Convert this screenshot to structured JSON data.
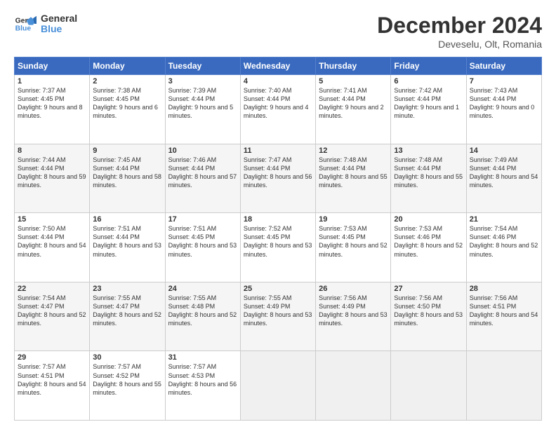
{
  "header": {
    "logo_general": "General",
    "logo_blue": "Blue",
    "month_title": "December 2024",
    "location": "Deveselu, Olt, Romania"
  },
  "days_of_week": [
    "Sunday",
    "Monday",
    "Tuesday",
    "Wednesday",
    "Thursday",
    "Friday",
    "Saturday"
  ],
  "weeks": [
    [
      {
        "day": "1",
        "sunrise": "Sunrise: 7:37 AM",
        "sunset": "Sunset: 4:45 PM",
        "daylight": "Daylight: 9 hours and 8 minutes."
      },
      {
        "day": "2",
        "sunrise": "Sunrise: 7:38 AM",
        "sunset": "Sunset: 4:45 PM",
        "daylight": "Daylight: 9 hours and 6 minutes."
      },
      {
        "day": "3",
        "sunrise": "Sunrise: 7:39 AM",
        "sunset": "Sunset: 4:44 PM",
        "daylight": "Daylight: 9 hours and 5 minutes."
      },
      {
        "day": "4",
        "sunrise": "Sunrise: 7:40 AM",
        "sunset": "Sunset: 4:44 PM",
        "daylight": "Daylight: 9 hours and 4 minutes."
      },
      {
        "day": "5",
        "sunrise": "Sunrise: 7:41 AM",
        "sunset": "Sunset: 4:44 PM",
        "daylight": "Daylight: 9 hours and 2 minutes."
      },
      {
        "day": "6",
        "sunrise": "Sunrise: 7:42 AM",
        "sunset": "Sunset: 4:44 PM",
        "daylight": "Daylight: 9 hours and 1 minute."
      },
      {
        "day": "7",
        "sunrise": "Sunrise: 7:43 AM",
        "sunset": "Sunset: 4:44 PM",
        "daylight": "Daylight: 9 hours and 0 minutes."
      }
    ],
    [
      {
        "day": "8",
        "sunrise": "Sunrise: 7:44 AM",
        "sunset": "Sunset: 4:44 PM",
        "daylight": "Daylight: 8 hours and 59 minutes."
      },
      {
        "day": "9",
        "sunrise": "Sunrise: 7:45 AM",
        "sunset": "Sunset: 4:44 PM",
        "daylight": "Daylight: 8 hours and 58 minutes."
      },
      {
        "day": "10",
        "sunrise": "Sunrise: 7:46 AM",
        "sunset": "Sunset: 4:44 PM",
        "daylight": "Daylight: 8 hours and 57 minutes."
      },
      {
        "day": "11",
        "sunrise": "Sunrise: 7:47 AM",
        "sunset": "Sunset: 4:44 PM",
        "daylight": "Daylight: 8 hours and 56 minutes."
      },
      {
        "day": "12",
        "sunrise": "Sunrise: 7:48 AM",
        "sunset": "Sunset: 4:44 PM",
        "daylight": "Daylight: 8 hours and 55 minutes."
      },
      {
        "day": "13",
        "sunrise": "Sunrise: 7:48 AM",
        "sunset": "Sunset: 4:44 PM",
        "daylight": "Daylight: 8 hours and 55 minutes."
      },
      {
        "day": "14",
        "sunrise": "Sunrise: 7:49 AM",
        "sunset": "Sunset: 4:44 PM",
        "daylight": "Daylight: 8 hours and 54 minutes."
      }
    ],
    [
      {
        "day": "15",
        "sunrise": "Sunrise: 7:50 AM",
        "sunset": "Sunset: 4:44 PM",
        "daylight": "Daylight: 8 hours and 54 minutes."
      },
      {
        "day": "16",
        "sunrise": "Sunrise: 7:51 AM",
        "sunset": "Sunset: 4:44 PM",
        "daylight": "Daylight: 8 hours and 53 minutes."
      },
      {
        "day": "17",
        "sunrise": "Sunrise: 7:51 AM",
        "sunset": "Sunset: 4:45 PM",
        "daylight": "Daylight: 8 hours and 53 minutes."
      },
      {
        "day": "18",
        "sunrise": "Sunrise: 7:52 AM",
        "sunset": "Sunset: 4:45 PM",
        "daylight": "Daylight: 8 hours and 53 minutes."
      },
      {
        "day": "19",
        "sunrise": "Sunrise: 7:53 AM",
        "sunset": "Sunset: 4:45 PM",
        "daylight": "Daylight: 8 hours and 52 minutes."
      },
      {
        "day": "20",
        "sunrise": "Sunrise: 7:53 AM",
        "sunset": "Sunset: 4:46 PM",
        "daylight": "Daylight: 8 hours and 52 minutes."
      },
      {
        "day": "21",
        "sunrise": "Sunrise: 7:54 AM",
        "sunset": "Sunset: 4:46 PM",
        "daylight": "Daylight: 8 hours and 52 minutes."
      }
    ],
    [
      {
        "day": "22",
        "sunrise": "Sunrise: 7:54 AM",
        "sunset": "Sunset: 4:47 PM",
        "daylight": "Daylight: 8 hours and 52 minutes."
      },
      {
        "day": "23",
        "sunrise": "Sunrise: 7:55 AM",
        "sunset": "Sunset: 4:47 PM",
        "daylight": "Daylight: 8 hours and 52 minutes."
      },
      {
        "day": "24",
        "sunrise": "Sunrise: 7:55 AM",
        "sunset": "Sunset: 4:48 PM",
        "daylight": "Daylight: 8 hours and 52 minutes."
      },
      {
        "day": "25",
        "sunrise": "Sunrise: 7:55 AM",
        "sunset": "Sunset: 4:49 PM",
        "daylight": "Daylight: 8 hours and 53 minutes."
      },
      {
        "day": "26",
        "sunrise": "Sunrise: 7:56 AM",
        "sunset": "Sunset: 4:49 PM",
        "daylight": "Daylight: 8 hours and 53 minutes."
      },
      {
        "day": "27",
        "sunrise": "Sunrise: 7:56 AM",
        "sunset": "Sunset: 4:50 PM",
        "daylight": "Daylight: 8 hours and 53 minutes."
      },
      {
        "day": "28",
        "sunrise": "Sunrise: 7:56 AM",
        "sunset": "Sunset: 4:51 PM",
        "daylight": "Daylight: 8 hours and 54 minutes."
      }
    ],
    [
      {
        "day": "29",
        "sunrise": "Sunrise: 7:57 AM",
        "sunset": "Sunset: 4:51 PM",
        "daylight": "Daylight: 8 hours and 54 minutes."
      },
      {
        "day": "30",
        "sunrise": "Sunrise: 7:57 AM",
        "sunset": "Sunset: 4:52 PM",
        "daylight": "Daylight: 8 hours and 55 minutes."
      },
      {
        "day": "31",
        "sunrise": "Sunrise: 7:57 AM",
        "sunset": "Sunset: 4:53 PM",
        "daylight": "Daylight: 8 hours and 56 minutes."
      },
      null,
      null,
      null,
      null
    ]
  ]
}
